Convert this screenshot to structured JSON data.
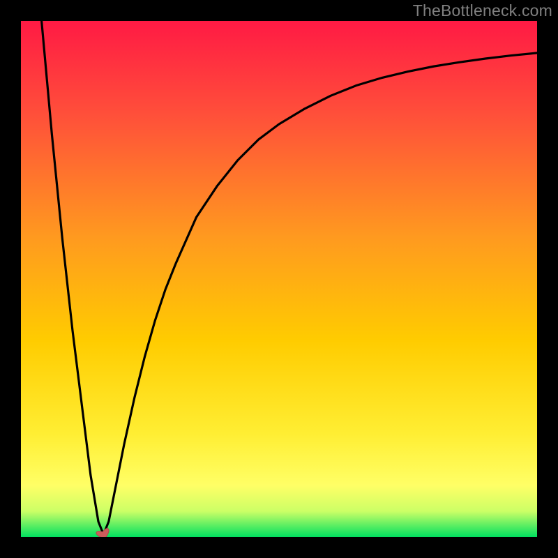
{
  "watermark": "TheBottleneck.com",
  "colors": {
    "frame": "#000000",
    "curve": "#000000",
    "marker_fill": "#cd5c5c",
    "marker_stroke": "#b04a4a",
    "gradient_top": "#ff1a44",
    "gradient_mid": "#ffcc00",
    "gradient_low": "#ffff66",
    "gradient_bottom": "#00e060"
  },
  "chart_data": {
    "type": "line",
    "title": "",
    "xlabel": "",
    "ylabel": "",
    "xlim": [
      0,
      100
    ],
    "ylim": [
      0,
      100
    ],
    "grid": false,
    "legend": null,
    "annotations": [],
    "series": [
      {
        "name": "bottleneck-curve",
        "x": [
          4,
          6,
          8,
          10,
          12,
          13.5,
          15,
          16,
          17,
          18,
          20,
          22,
          24,
          26,
          28,
          30,
          34,
          38,
          42,
          46,
          50,
          55,
          60,
          65,
          70,
          75,
          80,
          85,
          90,
          95,
          100
        ],
        "values": [
          100,
          78,
          58,
          40,
          24,
          12,
          3,
          0.5,
          3,
          8,
          18,
          27,
          35,
          42,
          48,
          53,
          62,
          68,
          73,
          77,
          80,
          83,
          85.5,
          87.5,
          89,
          90.2,
          91.2,
          92,
          92.7,
          93.3,
          93.8
        ]
      }
    ],
    "marker": {
      "name": "optimal-point-marker",
      "x": 16,
      "y": 0.5,
      "shape": "heart"
    }
  }
}
